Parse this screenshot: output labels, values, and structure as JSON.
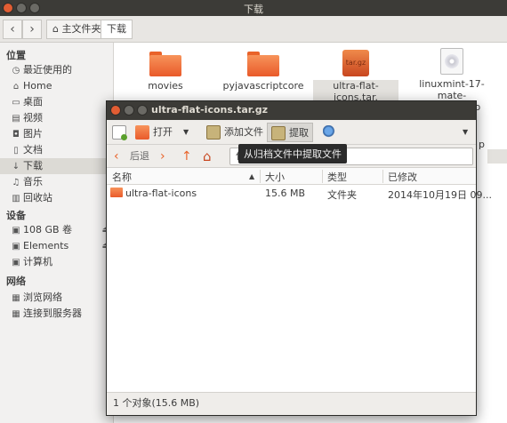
{
  "file_manager": {
    "title": "下载",
    "breadcrumb": {
      "home_label": "主文件夹",
      "current_label": "下载"
    },
    "sidebar": {
      "places_header": "位置",
      "places": [
        {
          "label": "最近使用的",
          "icon": "clock-icon"
        },
        {
          "label": "Home",
          "icon": "home-icon"
        },
        {
          "label": "桌面",
          "icon": "desktop-icon"
        },
        {
          "label": "视频",
          "icon": "video-icon"
        },
        {
          "label": "图片",
          "icon": "camera-icon"
        },
        {
          "label": "文档",
          "icon": "document-icon"
        },
        {
          "label": "下载",
          "icon": "download-icon"
        },
        {
          "label": "音乐",
          "icon": "music-icon"
        },
        {
          "label": "回收站",
          "icon": "trash-icon"
        }
      ],
      "devices_header": "设备",
      "devices": [
        {
          "label": "108 GB 卷",
          "icon": "drive-icon"
        },
        {
          "label": "Elements",
          "icon": "drive-icon"
        },
        {
          "label": "计算机",
          "icon": "drive-icon"
        }
      ],
      "network_header": "网络",
      "network": [
        {
          "label": "浏览网络",
          "icon": "network-icon"
        },
        {
          "label": "连接到服务器",
          "icon": "server-icon"
        }
      ]
    },
    "files": [
      {
        "name": "movies",
        "icon": "folder-icon"
      },
      {
        "name": "pyjavascriptcore",
        "icon": "folder-icon"
      },
      {
        "name_line1": "ultra-flat-icons.tar.",
        "name_line2": "gz",
        "icon": "archive-icon",
        "icon_text": "tar.gz"
      },
      {
        "name_line1": "linuxmint-17-mate-",
        "name_line2": "32bit-v2.iso",
        "icon": "disc-icon"
      }
    ],
    "partial_letter": "p"
  },
  "archive_manager": {
    "title": "ultra-flat-icons.tar.gz",
    "toolbar": {
      "open_label": "打开",
      "add_files_label": "添加文件",
      "extract_label": "提取"
    },
    "navbar": {
      "back_label": "后退",
      "location_prefix": "位"
    },
    "tooltip": "从归档文件中提取文件",
    "columns": {
      "name": "名称",
      "size": "大小",
      "type": "类型",
      "modified": "已修改"
    },
    "rows": [
      {
        "name": "ultra-flat-icons",
        "size": "15.6 MB",
        "type": "文件夹",
        "modified": "2014年10月19日 09..."
      }
    ],
    "status": "1 个对象(15.6 MB)"
  },
  "colors": {
    "accent": "#e95a2a",
    "titlebar": "#3c3b37",
    "close_button": "#e25d33"
  }
}
